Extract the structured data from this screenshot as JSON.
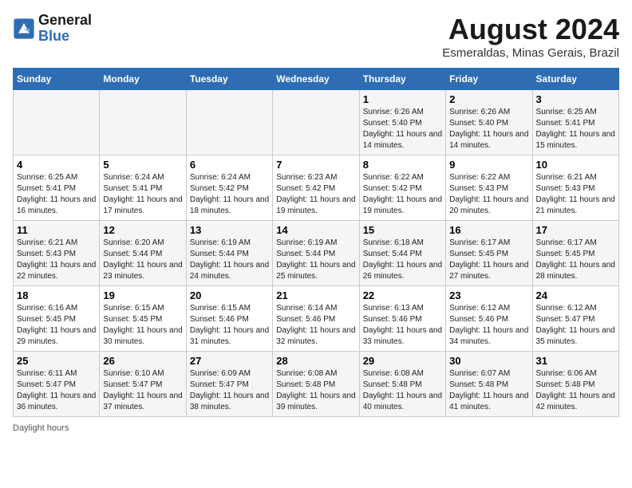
{
  "logo": {
    "line1": "General",
    "line2": "Blue"
  },
  "title": "August 2024",
  "subtitle": "Esmeraldas, Minas Gerais, Brazil",
  "days_of_week": [
    "Sunday",
    "Monday",
    "Tuesday",
    "Wednesday",
    "Thursday",
    "Friday",
    "Saturday"
  ],
  "footer": "Daylight hours",
  "weeks": [
    [
      {
        "day": "",
        "sunrise": "",
        "sunset": "",
        "daylight": ""
      },
      {
        "day": "",
        "sunrise": "",
        "sunset": "",
        "daylight": ""
      },
      {
        "day": "",
        "sunrise": "",
        "sunset": "",
        "daylight": ""
      },
      {
        "day": "",
        "sunrise": "",
        "sunset": "",
        "daylight": ""
      },
      {
        "day": "1",
        "sunrise": "6:26 AM",
        "sunset": "5:40 PM",
        "daylight": "11 hours and 14 minutes."
      },
      {
        "day": "2",
        "sunrise": "6:26 AM",
        "sunset": "5:40 PM",
        "daylight": "11 hours and 14 minutes."
      },
      {
        "day": "3",
        "sunrise": "6:25 AM",
        "sunset": "5:41 PM",
        "daylight": "11 hours and 15 minutes."
      }
    ],
    [
      {
        "day": "4",
        "sunrise": "6:25 AM",
        "sunset": "5:41 PM",
        "daylight": "11 hours and 16 minutes."
      },
      {
        "day": "5",
        "sunrise": "6:24 AM",
        "sunset": "5:41 PM",
        "daylight": "11 hours and 17 minutes."
      },
      {
        "day": "6",
        "sunrise": "6:24 AM",
        "sunset": "5:42 PM",
        "daylight": "11 hours and 18 minutes."
      },
      {
        "day": "7",
        "sunrise": "6:23 AM",
        "sunset": "5:42 PM",
        "daylight": "11 hours and 19 minutes."
      },
      {
        "day": "8",
        "sunrise": "6:22 AM",
        "sunset": "5:42 PM",
        "daylight": "11 hours and 19 minutes."
      },
      {
        "day": "9",
        "sunrise": "6:22 AM",
        "sunset": "5:43 PM",
        "daylight": "11 hours and 20 minutes."
      },
      {
        "day": "10",
        "sunrise": "6:21 AM",
        "sunset": "5:43 PM",
        "daylight": "11 hours and 21 minutes."
      }
    ],
    [
      {
        "day": "11",
        "sunrise": "6:21 AM",
        "sunset": "5:43 PM",
        "daylight": "11 hours and 22 minutes."
      },
      {
        "day": "12",
        "sunrise": "6:20 AM",
        "sunset": "5:44 PM",
        "daylight": "11 hours and 23 minutes."
      },
      {
        "day": "13",
        "sunrise": "6:19 AM",
        "sunset": "5:44 PM",
        "daylight": "11 hours and 24 minutes."
      },
      {
        "day": "14",
        "sunrise": "6:19 AM",
        "sunset": "5:44 PM",
        "daylight": "11 hours and 25 minutes."
      },
      {
        "day": "15",
        "sunrise": "6:18 AM",
        "sunset": "5:44 PM",
        "daylight": "11 hours and 26 minutes."
      },
      {
        "day": "16",
        "sunrise": "6:17 AM",
        "sunset": "5:45 PM",
        "daylight": "11 hours and 27 minutes."
      },
      {
        "day": "17",
        "sunrise": "6:17 AM",
        "sunset": "5:45 PM",
        "daylight": "11 hours and 28 minutes."
      }
    ],
    [
      {
        "day": "18",
        "sunrise": "6:16 AM",
        "sunset": "5:45 PM",
        "daylight": "11 hours and 29 minutes."
      },
      {
        "day": "19",
        "sunrise": "6:15 AM",
        "sunset": "5:45 PM",
        "daylight": "11 hours and 30 minutes."
      },
      {
        "day": "20",
        "sunrise": "6:15 AM",
        "sunset": "5:46 PM",
        "daylight": "11 hours and 31 minutes."
      },
      {
        "day": "21",
        "sunrise": "6:14 AM",
        "sunset": "5:46 PM",
        "daylight": "11 hours and 32 minutes."
      },
      {
        "day": "22",
        "sunrise": "6:13 AM",
        "sunset": "5:46 PM",
        "daylight": "11 hours and 33 minutes."
      },
      {
        "day": "23",
        "sunrise": "6:12 AM",
        "sunset": "5:46 PM",
        "daylight": "11 hours and 34 minutes."
      },
      {
        "day": "24",
        "sunrise": "6:12 AM",
        "sunset": "5:47 PM",
        "daylight": "11 hours and 35 minutes."
      }
    ],
    [
      {
        "day": "25",
        "sunrise": "6:11 AM",
        "sunset": "5:47 PM",
        "daylight": "11 hours and 36 minutes."
      },
      {
        "day": "26",
        "sunrise": "6:10 AM",
        "sunset": "5:47 PM",
        "daylight": "11 hours and 37 minutes."
      },
      {
        "day": "27",
        "sunrise": "6:09 AM",
        "sunset": "5:47 PM",
        "daylight": "11 hours and 38 minutes."
      },
      {
        "day": "28",
        "sunrise": "6:08 AM",
        "sunset": "5:48 PM",
        "daylight": "11 hours and 39 minutes."
      },
      {
        "day": "29",
        "sunrise": "6:08 AM",
        "sunset": "5:48 PM",
        "daylight": "11 hours and 40 minutes."
      },
      {
        "day": "30",
        "sunrise": "6:07 AM",
        "sunset": "5:48 PM",
        "daylight": "11 hours and 41 minutes."
      },
      {
        "day": "31",
        "sunrise": "6:06 AM",
        "sunset": "5:48 PM",
        "daylight": "11 hours and 42 minutes."
      }
    ]
  ]
}
